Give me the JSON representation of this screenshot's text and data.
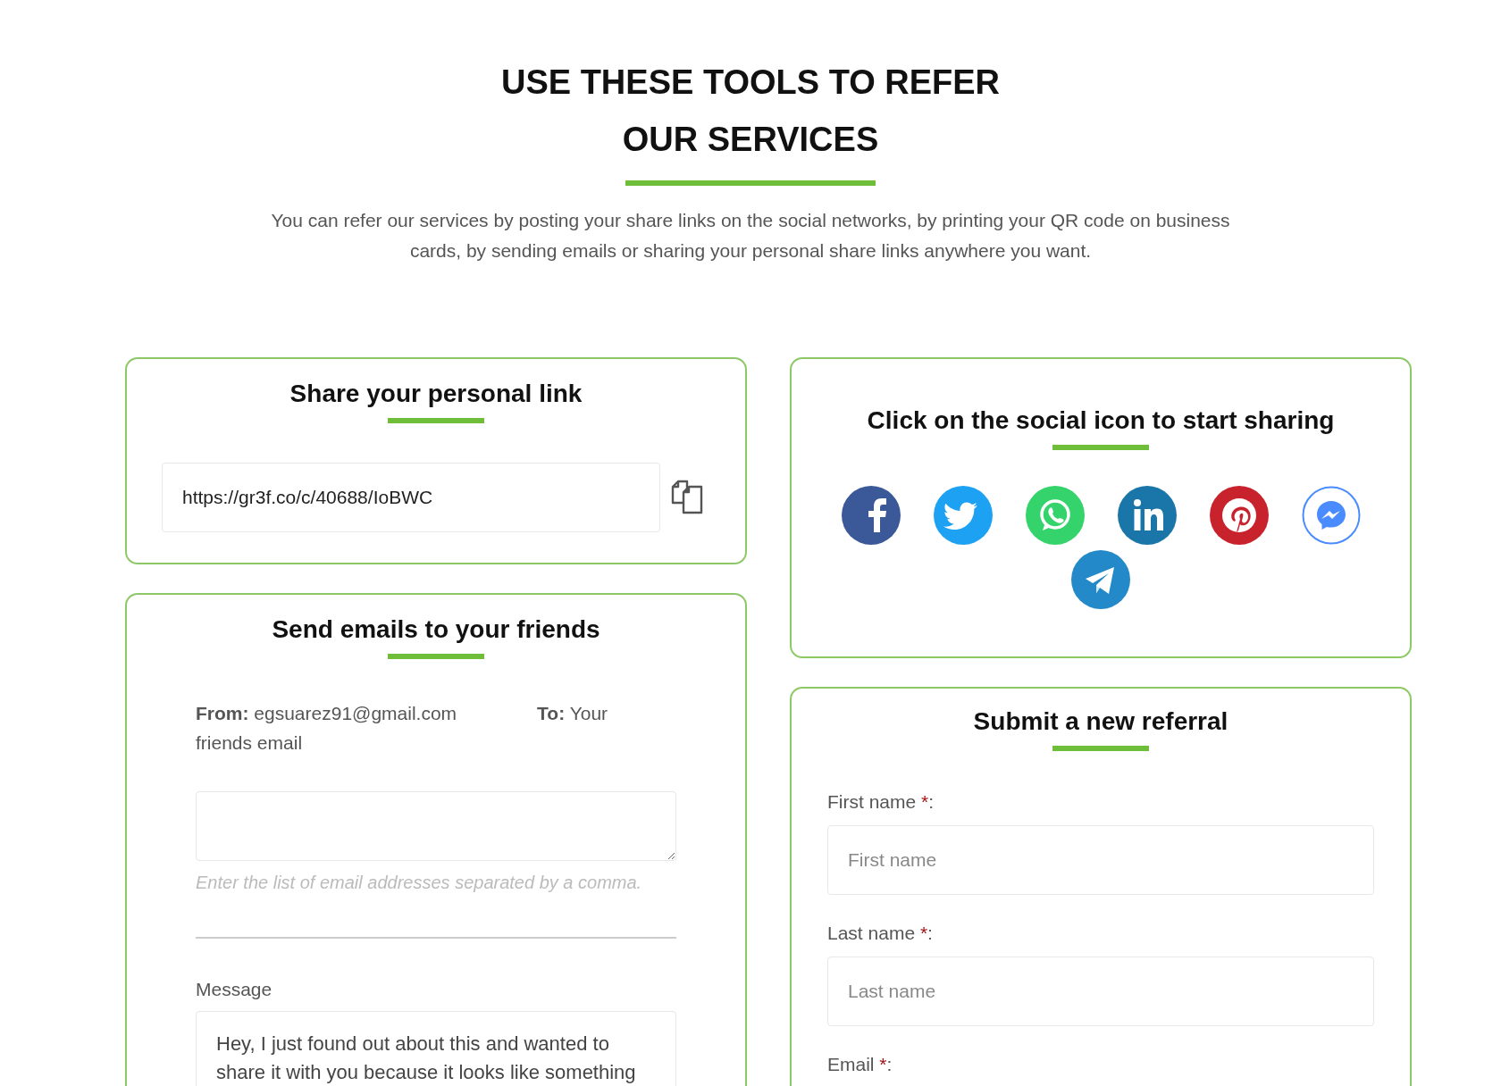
{
  "header": {
    "title_lines": [
      "USE THESE TOOLS TO REFER",
      "OUR SERVICES"
    ],
    "intro": "You can refer our services by posting your share links on the social networks, by printing your QR code on business cards, by sending emails or sharing your personal share links anywhere you want."
  },
  "share_link": {
    "title": "Share your personal link",
    "value": "https://gr3f.co/c/40688/IoBWC"
  },
  "email": {
    "title": "Send emails to your friends",
    "from": "**From:** egsuarez91@gmail.com",
    "to": "**To:** Your friends email",
    "help": "Enter the list of email addresses separated by a comma.",
    "message_label": "Message",
    "message": "Hey, I just found out about this and wanted to share it with you because it looks like something"
  },
  "social": {
    "title": "Click on the social icon to start sharing",
    "networks": [
      {
        "kind": "facebook"
      },
      {
        "kind": "twitter"
      },
      {
        "kind": "whatsapp"
      },
      {
        "kind": "linkedin"
      },
      {
        "kind": "pinterest"
      },
      {
        "kind": "messenger"
      },
      {
        "kind": "telegram"
      }
    ]
  },
  "referral": {
    "title": "Submit a new referral",
    "fields": [
      {
        "label": "First name",
        "marker": "*",
        "suffix": ":",
        "placeholder": "First name"
      },
      {
        "label": "Last name",
        "marker": "*",
        "suffix": ":",
        "placeholder": "Last name"
      },
      {
        "label": "Email",
        "marker": "*",
        "suffix": ":"
      }
    ]
  }
}
